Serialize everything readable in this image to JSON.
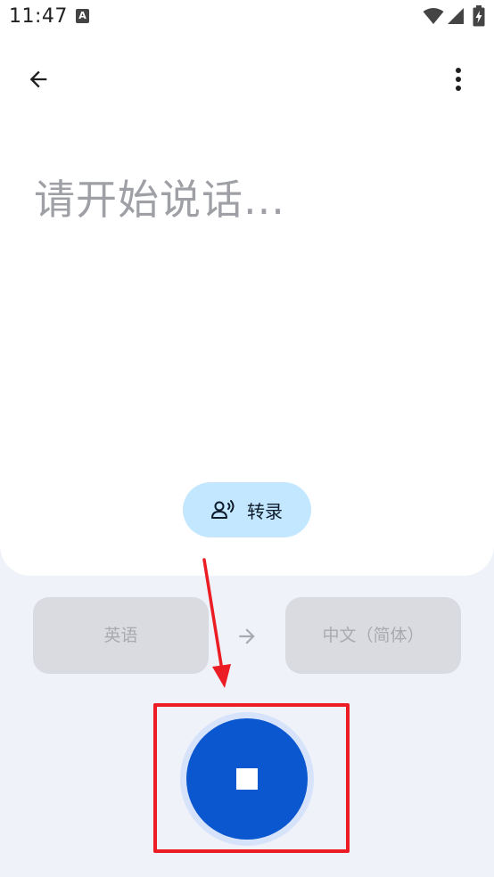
{
  "status_bar": {
    "time": "11:47",
    "notification_badge": "A",
    "icons": [
      "wifi-icon",
      "signal-icon",
      "battery-charging-icon"
    ]
  },
  "toolbar": {
    "back_icon": "arrow-back-icon",
    "more_icon": "more-vert-icon"
  },
  "transcript": {
    "placeholder": "请开始说话..."
  },
  "transcribe_button": {
    "icon": "voice-person-icon",
    "label": "转录"
  },
  "languages": {
    "source": "英语",
    "target": "中文（简体）",
    "arrow_icon": "arrow-forward-icon"
  },
  "mic_button": {
    "state": "recording",
    "icon": "stop-icon"
  },
  "colors": {
    "accent": "#0b57d0",
    "transcribe_bg": "#c3e7fe",
    "annotation": "#ec1c24",
    "background": "#eff2f8"
  }
}
